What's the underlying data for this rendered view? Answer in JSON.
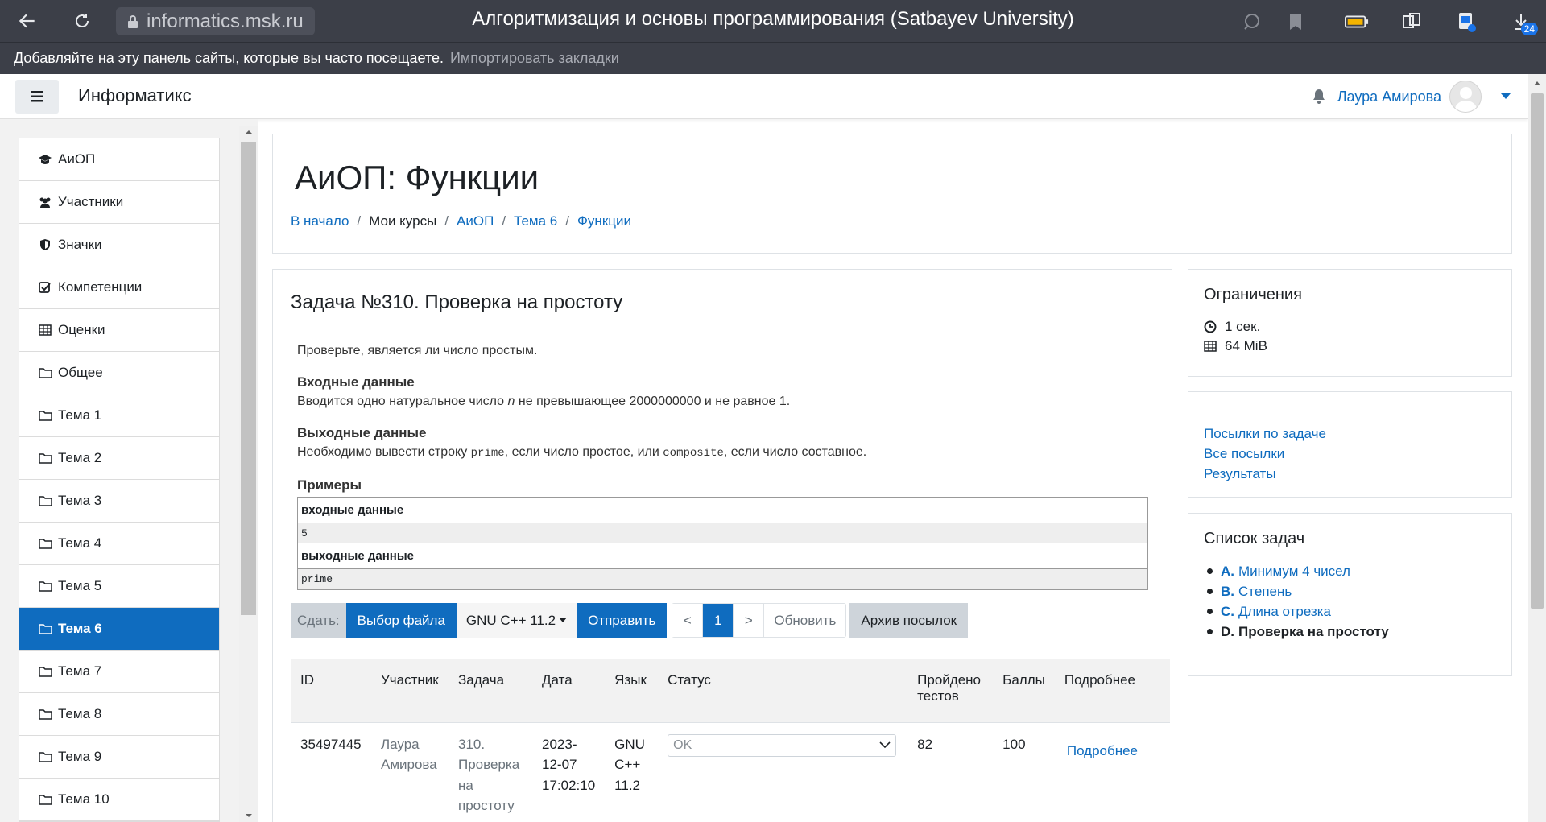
{
  "browser": {
    "url": "informatics.msk.ru",
    "tab_title": "Алгоритмизация и основы программирования (Satbayev University)",
    "downloads_badge": "24",
    "bookmarks_message": "Добавляйте на эту панель сайты, которые вы часто посещаете.",
    "bookmarks_import": "Импортировать закладки"
  },
  "header": {
    "brand": "Информатикс",
    "user_name": "Лаура Амирова"
  },
  "drawer": {
    "items": [
      {
        "label": "АиОП",
        "icon": "graduation-cap-icon"
      },
      {
        "label": "Участники",
        "icon": "users-icon"
      },
      {
        "label": "Значки",
        "icon": "shield-icon"
      },
      {
        "label": "Компетенции",
        "icon": "checkbox-icon"
      },
      {
        "label": "Оценки",
        "icon": "table-icon"
      },
      {
        "label": "Общее",
        "icon": "folder-icon"
      },
      {
        "label": "Тема 1",
        "icon": "folder-icon"
      },
      {
        "label": "Тема 2",
        "icon": "folder-icon"
      },
      {
        "label": "Тема 3",
        "icon": "folder-icon"
      },
      {
        "label": "Тема 4",
        "icon": "folder-icon"
      },
      {
        "label": "Тема 5",
        "icon": "folder-icon"
      },
      {
        "label": "Тема 6",
        "icon": "folder-icon",
        "active": true
      },
      {
        "label": "Тема 7",
        "icon": "folder-icon"
      },
      {
        "label": "Тема 8",
        "icon": "folder-icon"
      },
      {
        "label": "Тема 9",
        "icon": "folder-icon"
      },
      {
        "label": "Тема 10",
        "icon": "folder-icon"
      }
    ]
  },
  "page": {
    "title": "АиОП: Функции",
    "breadcrumb": [
      "В начало",
      "Мои курсы",
      "АиОП",
      "Тема 6",
      "Функции"
    ]
  },
  "problem": {
    "title": "Задача №310. Проверка на простоту",
    "intro": "Проверьте, является ли число простым.",
    "input_heading": "Входные данные",
    "input_text_1": "Вводится одно натуральное число ",
    "input_var": "n",
    "input_text_2": " не превышающее 2000000000 и не равное 1.",
    "output_heading": "Выходные данные",
    "output_text_1": "Необходимо вывести  строку ",
    "output_code_1": "prime",
    "output_text_2": ", если число простое, или ",
    "output_code_2": "composite",
    "output_text_3": ", если число составное.",
    "examples_heading": "Примеры",
    "sample_input_label": "входные данные",
    "sample_input": "5",
    "sample_output_label": "выходные данные",
    "sample_output": "prime"
  },
  "submit": {
    "label": "Сдать:",
    "choose_file": "Выбор файла",
    "language": "GNU C++ 11.2",
    "send": "Отправить",
    "prev": "<",
    "page": "1",
    "next": ">",
    "refresh": "Обновить",
    "archive": "Архив посылок"
  },
  "runs": {
    "headers": [
      "ID",
      "Участник",
      "Задача",
      "Дата",
      "Язык",
      "Статус",
      "Пройдено тестов",
      "Баллы",
      "Подробнее"
    ],
    "rows": [
      {
        "id": "35497445",
        "participant": "Лаура Амирова",
        "task": "310. Проверка на простоту",
        "date": "2023-12-07 17:02:10",
        "lang": "GNU C++ 11.2",
        "status": "OK",
        "tests": "82",
        "score": "100",
        "details": "Подробнее"
      }
    ]
  },
  "limits": {
    "title": "Ограничения",
    "time": "1 сек.",
    "memory": "64 MiB"
  },
  "links": {
    "items": [
      "Посылки по задаче",
      "Все посылки",
      "Результаты"
    ]
  },
  "tasks": {
    "title": "Список задач",
    "items": [
      {
        "letter": "A.",
        "name": "Минимум 4 чисел"
      },
      {
        "letter": "B.",
        "name": "Степень"
      },
      {
        "letter": "C.",
        "name": "Длина отрезка"
      },
      {
        "letter": "D.",
        "name": "Проверка на простоту",
        "current": true
      }
    ]
  },
  "colors": {
    "accent": "#0f6cbf",
    "browser_chrome": "#3c3f48"
  }
}
